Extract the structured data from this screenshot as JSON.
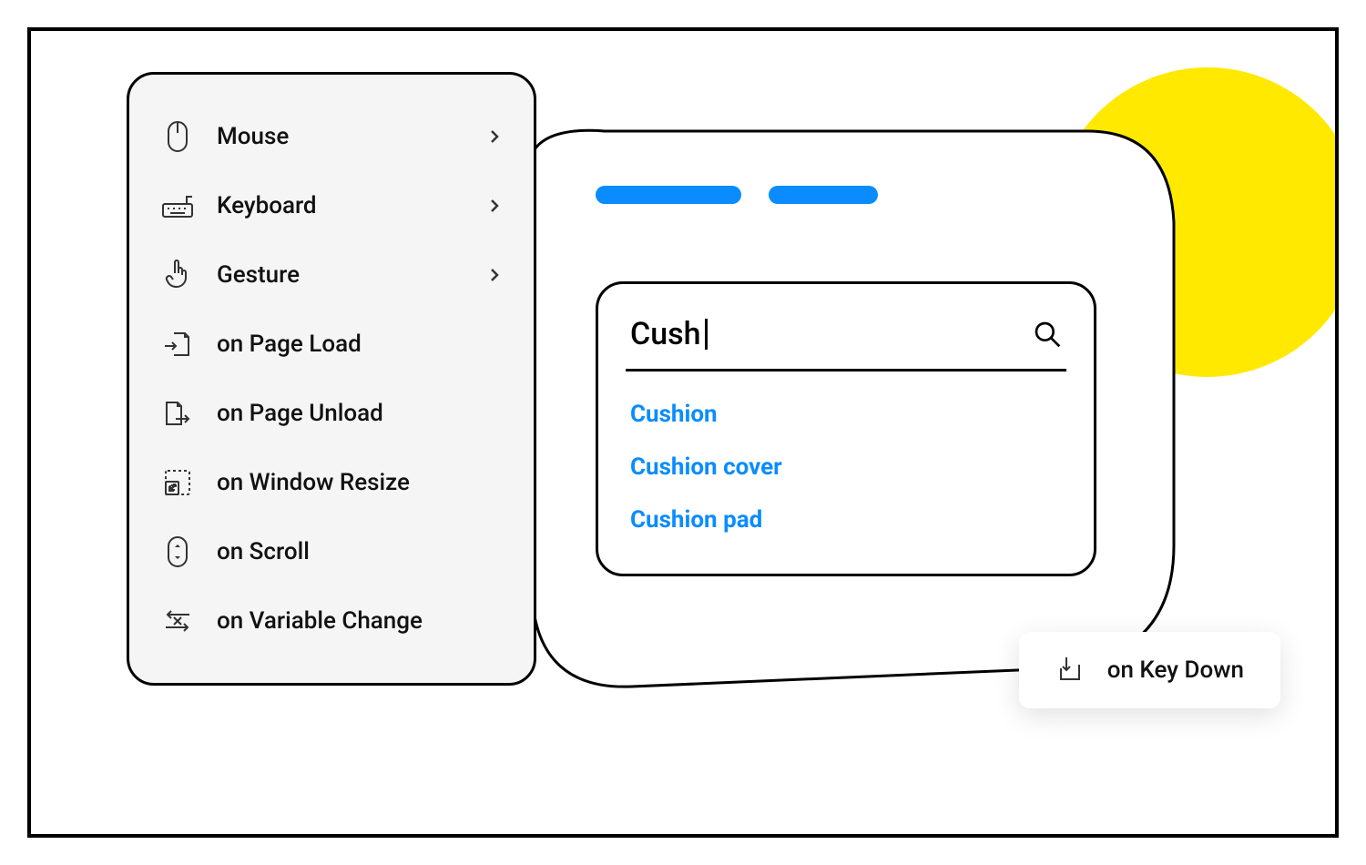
{
  "menu": {
    "items": [
      {
        "label": "Mouse",
        "icon": "mouse-icon",
        "has_submenu": true
      },
      {
        "label": "Keyboard",
        "icon": "keyboard-icon",
        "has_submenu": true
      },
      {
        "label": "Gesture",
        "icon": "gesture-icon",
        "has_submenu": true
      },
      {
        "label": "on Page Load",
        "icon": "page-load-icon",
        "has_submenu": false
      },
      {
        "label": "on Page Unload",
        "icon": "page-unload-icon",
        "has_submenu": false
      },
      {
        "label": "on Window Resize",
        "icon": "window-resize-icon",
        "has_submenu": false
      },
      {
        "label": "on Scroll",
        "icon": "scroll-icon",
        "has_submenu": false
      },
      {
        "label": "on Variable Change",
        "icon": "variable-change-icon",
        "has_submenu": false
      }
    ]
  },
  "search": {
    "value": "Cush",
    "suggestions": [
      "Cushion",
      "Cushion cover",
      "Cushion pad"
    ]
  },
  "chip": {
    "label": "on Key Down"
  },
  "colors": {
    "accent_blue": "#0a8cff",
    "accent_yellow": "#ffe400"
  }
}
